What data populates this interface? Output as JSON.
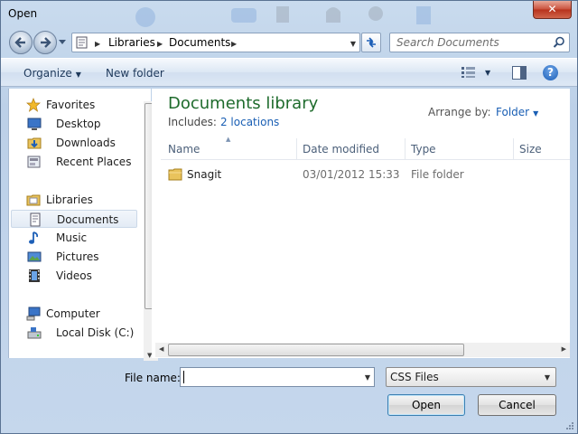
{
  "window": {
    "title": "Open",
    "close_label": "✕"
  },
  "nav": {
    "breadcrumb": [
      "Libraries",
      "Documents"
    ],
    "search_placeholder": "Search Documents"
  },
  "toolbar": {
    "organize_label": "Organize",
    "new_folder_label": "New folder"
  },
  "sidebar": {
    "favorites": {
      "label": "Favorites",
      "icon": "star-icon"
    },
    "favorite_items": [
      {
        "label": "Desktop",
        "icon": "desktop-icon"
      },
      {
        "label": "Downloads",
        "icon": "downloads-icon"
      },
      {
        "label": "Recent Places",
        "icon": "recent-places-icon"
      }
    ],
    "libraries": {
      "label": "Libraries",
      "icon": "libraries-icon"
    },
    "library_items": [
      {
        "label": "Documents",
        "icon": "documents-icon",
        "selected": true
      },
      {
        "label": "Music",
        "icon": "music-icon"
      },
      {
        "label": "Pictures",
        "icon": "pictures-icon"
      },
      {
        "label": "Videos",
        "icon": "videos-icon"
      }
    ],
    "computer": {
      "label": "Computer",
      "icon": "computer-icon"
    },
    "computer_items": [
      {
        "label": "Local Disk (C:)",
        "icon": "local-disk-icon"
      }
    ]
  },
  "library": {
    "title": "Documents library",
    "includes_label": "Includes:",
    "includes_link": "2 locations",
    "arrange_label": "Arrange by:",
    "arrange_value": "Folder"
  },
  "columns": {
    "name": "Name",
    "date": "Date modified",
    "type": "Type",
    "size": "Size"
  },
  "files": [
    {
      "name": "Snagit",
      "date": "03/01/2012 15:33",
      "type": "File folder"
    }
  ],
  "footer": {
    "filename_label": "File name:",
    "filename_value": "",
    "filetype_value": "CSS Files",
    "open_label": "Open",
    "cancel_label": "Cancel"
  },
  "colors": {
    "accent_green": "#1e6b2c",
    "link_blue": "#1a5fb4",
    "toolbar_text": "#1e395b"
  }
}
